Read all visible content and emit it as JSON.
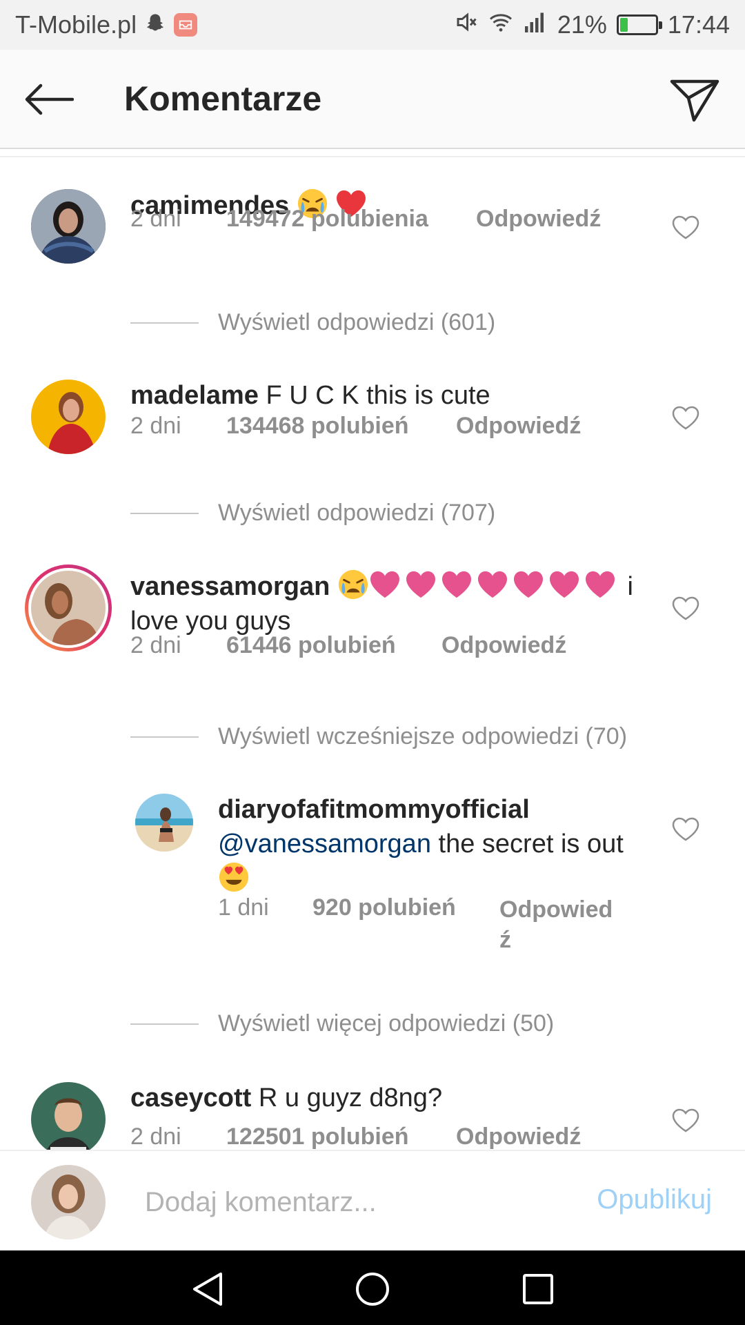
{
  "status_bar": {
    "carrier": "T-Mobile.pl",
    "battery_percent": "21%",
    "battery_level": 0.21,
    "time": "17:44",
    "icons": [
      "snapchat-icon",
      "mail-icon",
      "mute-icon",
      "wifi-icon",
      "signal-icon",
      "battery-icon"
    ]
  },
  "header": {
    "title": "Komentarze",
    "back_icon": "arrow-left-icon",
    "send_icon": "paper-plane-icon"
  },
  "comments": [
    {
      "username": "camimendes",
      "text": "",
      "emojis": [
        "crying-face",
        "red-heart"
      ],
      "age": "2 dni",
      "likes": "149472 polubienia",
      "reply": "Odpowiedź",
      "view_replies": "Wyświetl odpowiedzi (601)"
    },
    {
      "username": "madelame",
      "text": "F U C K this is cute",
      "age": "2 dni",
      "likes": "134468 polubień",
      "reply": "Odpowiedź",
      "view_replies": "Wyświetl odpowiedzi (707)"
    },
    {
      "username": "vanessamorgan",
      "text_after_emojis": "i love you guys",
      "emojis": [
        "crying-face",
        "pink-heart",
        "pink-heart",
        "pink-heart",
        "pink-heart",
        "pink-heart",
        "pink-heart",
        "pink-heart"
      ],
      "age": "2 dni",
      "likes": "61446 polubień",
      "reply": "Odpowiedź",
      "view_replies": "Wyświetl wcześniejsze odpowiedzi (70)"
    },
    {
      "username": "diaryofafitmommyofficial",
      "mention": "@vanessamorgan",
      "text": "the secret is out",
      "emojis": [
        "heart-eyes-face"
      ],
      "age": "1 dni",
      "likes": "920 polubień",
      "reply": "Odpowiedź",
      "view_replies": "Wyświetl więcej odpowiedzi (50)"
    },
    {
      "username": "caseycott",
      "text": "R u guyz d8ng?",
      "age": "2 dni",
      "likes": "122501 polubień",
      "reply": "Odpowiedź"
    }
  ],
  "composer": {
    "placeholder": "Dodaj komentarz...",
    "publish_label": "Opublikuj"
  },
  "colors": {
    "text": "#262626",
    "secondary_text": "#8e8e8e",
    "mention": "#003569",
    "publish_disabled": "#9fd0f5",
    "story_ring": "#e1306c",
    "emoji_heart_pink": "#e5528d",
    "emoji_heart_red": "#e8363c"
  }
}
